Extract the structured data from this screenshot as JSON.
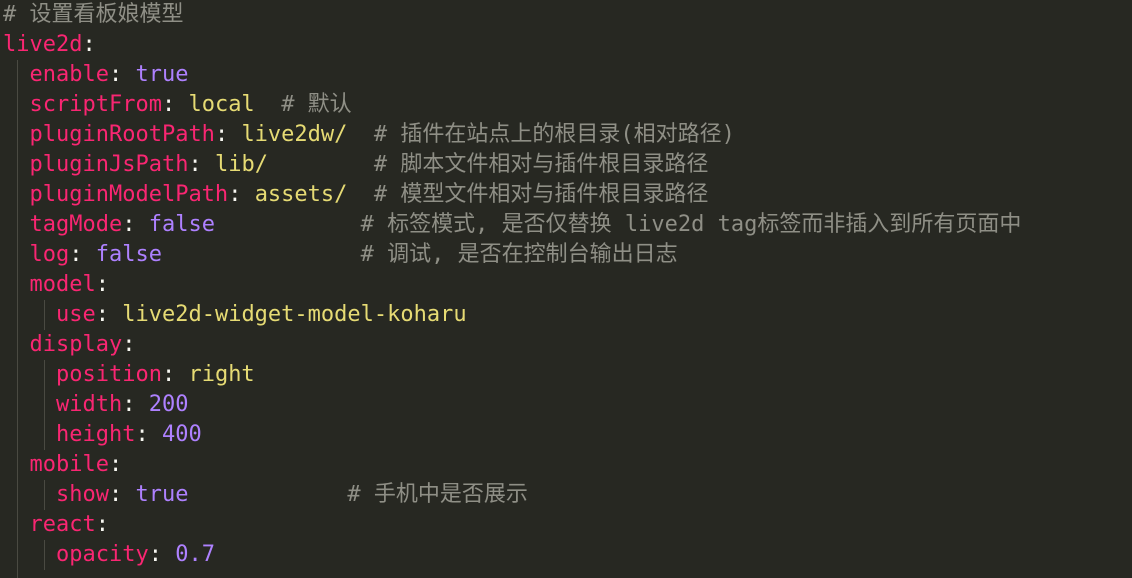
{
  "lines": [
    {
      "indent": "",
      "key": "",
      "value": "",
      "value_type": "",
      "gap": "",
      "comment": "# 设置看板娘模型"
    },
    {
      "indent": "",
      "key": "live2d",
      "value": "",
      "value_type": "",
      "gap": "",
      "comment": ""
    },
    {
      "indent": "  ",
      "key": "enable",
      "value": "true",
      "value_type": "kw",
      "gap": "",
      "comment": ""
    },
    {
      "indent": "  ",
      "key": "scriptFrom",
      "value": "local",
      "value_type": "str",
      "gap": "  ",
      "comment": "# 默认"
    },
    {
      "indent": "  ",
      "key": "pluginRootPath",
      "value": "live2dw/",
      "value_type": "str",
      "gap": "  ",
      "comment": "# 插件在站点上的根目录(相对路径)"
    },
    {
      "indent": "  ",
      "key": "pluginJsPath",
      "value": "lib/",
      "value_type": "str",
      "gap": "        ",
      "comment": "# 脚本文件相对与插件根目录路径"
    },
    {
      "indent": "  ",
      "key": "pluginModelPath",
      "value": "assets/",
      "value_type": "str",
      "gap": "  ",
      "comment": "# 模型文件相对与插件根目录路径"
    },
    {
      "indent": "  ",
      "key": "tagMode",
      "value": "false",
      "value_type": "kw",
      "gap": "           ",
      "comment": "# 标签模式, 是否仅替换 live2d tag标签而非插入到所有页面中"
    },
    {
      "indent": "  ",
      "key": "log",
      "value": "false",
      "value_type": "kw",
      "gap": "               ",
      "comment": "# 调试, 是否在控制台输出日志"
    },
    {
      "indent": "  ",
      "key": "model",
      "value": "",
      "value_type": "",
      "gap": "",
      "comment": ""
    },
    {
      "indent": "    ",
      "key": "use",
      "value": "live2d-widget-model-koharu",
      "value_type": "str",
      "gap": "",
      "comment": ""
    },
    {
      "indent": "  ",
      "key": "display",
      "value": "",
      "value_type": "",
      "gap": "",
      "comment": ""
    },
    {
      "indent": "    ",
      "key": "position",
      "value": "right",
      "value_type": "str",
      "gap": "",
      "comment": ""
    },
    {
      "indent": "    ",
      "key": "width",
      "value": "200",
      "value_type": "num",
      "gap": "",
      "comment": ""
    },
    {
      "indent": "    ",
      "key": "height",
      "value": "400",
      "value_type": "num",
      "gap": "",
      "comment": ""
    },
    {
      "indent": "  ",
      "key": "mobile",
      "value": "",
      "value_type": "",
      "gap": "",
      "comment": ""
    },
    {
      "indent": "    ",
      "key": "show",
      "value": "true",
      "value_type": "kw",
      "gap": "            ",
      "comment": "# 手机中是否展示"
    },
    {
      "indent": "  ",
      "key": "react",
      "value": "",
      "value_type": "",
      "gap": "",
      "comment": ""
    },
    {
      "indent": "    ",
      "key": "opacity",
      "value": "0.7",
      "value_type": "num",
      "gap": "",
      "comment": ""
    }
  ],
  "colors": {
    "background": "#272822",
    "key": "#f92672",
    "string": "#e6db74",
    "keyword": "#ae81ff",
    "comment": "#8f8f86",
    "text": "#f8f8f2"
  }
}
